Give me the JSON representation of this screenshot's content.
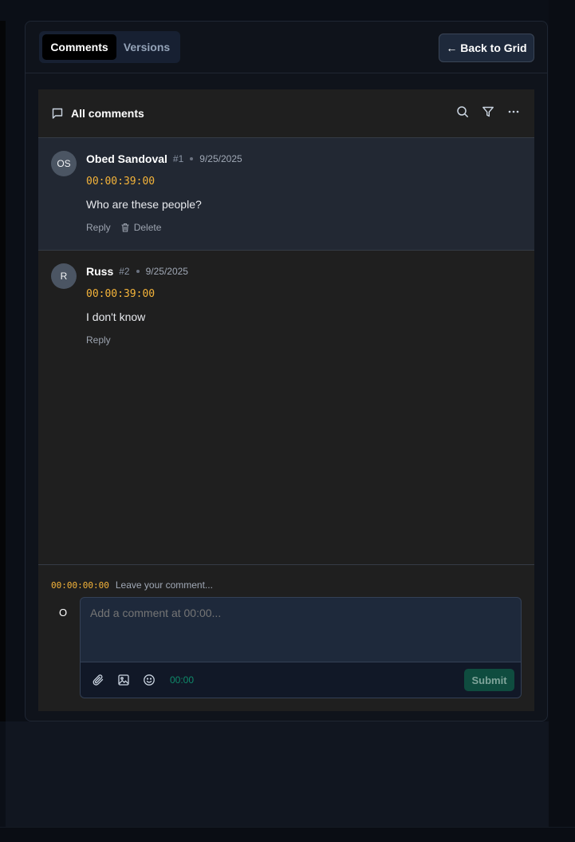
{
  "tabs": [
    {
      "label": "Comments",
      "active": true
    },
    {
      "label": "Versions",
      "active": false
    }
  ],
  "header": {
    "back_label": "← Back to Grid"
  },
  "comments_panel": {
    "title": "All comments",
    "icons": [
      "comment-icon",
      "search-icon",
      "filter-icon",
      "more-icon"
    ]
  },
  "comments": [
    {
      "initials": "OS",
      "author": "Obed Sandoval",
      "number": "#1",
      "date": "9/25/2025",
      "timecode": "00:00:39:00",
      "text": "Who are these people?",
      "reply_label": "Reply",
      "delete_label": "Delete"
    },
    {
      "initials": "R",
      "author": "Russ",
      "number": "#2",
      "date": "9/25/2025",
      "timecode": "00:00:39:00",
      "text": "I don't know",
      "reply_label": "Reply"
    }
  ],
  "composer": {
    "timecode": "00:00:00:00",
    "hint": "Leave your comment...",
    "avatar_initial": "O",
    "placeholder": "Add a comment at 00:00...",
    "time_label": "00:00",
    "submit_label": "Submit"
  },
  "colors": {
    "accent_timecode": "#f5b43a",
    "submit_bg": "#0f4c3f",
    "panel_bg": "#0f131b",
    "comments_bg": "#1f1f1f"
  }
}
